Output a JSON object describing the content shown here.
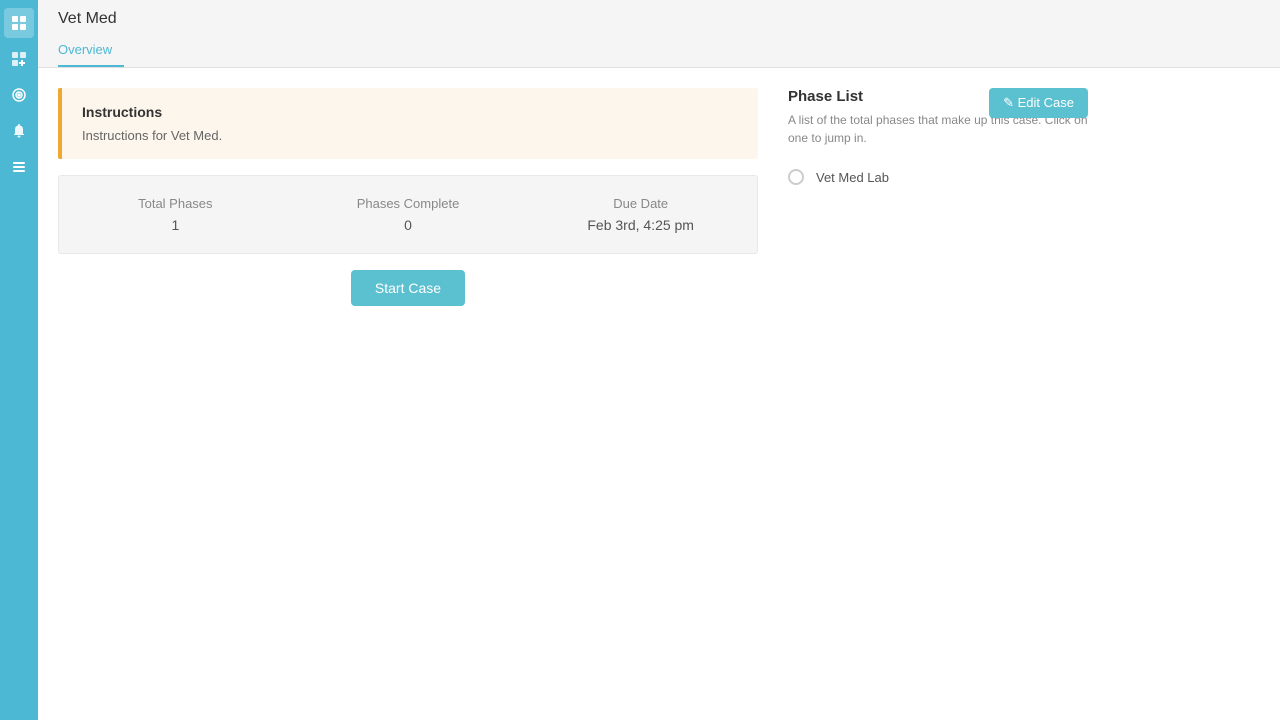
{
  "sidebar": {
    "icons": [
      {
        "name": "grid-icon",
        "symbol": "⊞"
      },
      {
        "name": "add-icon",
        "symbol": "⊕"
      },
      {
        "name": "target-icon",
        "symbol": "◎"
      },
      {
        "name": "bell-icon",
        "symbol": "🔔"
      },
      {
        "name": "list-icon",
        "symbol": "☰"
      }
    ]
  },
  "topbar": {
    "title": "Vet Med",
    "tabs": [
      {
        "label": "Overview",
        "active": true
      }
    ]
  },
  "edit_case_button": "✎ Edit Case",
  "instructions": {
    "title": "Instructions",
    "text": "Instructions for Vet Med."
  },
  "stats": {
    "total_phases_label": "Total Phases",
    "total_phases_value": "1",
    "phases_complete_label": "Phases Complete",
    "phases_complete_value": "0",
    "due_date_label": "Due Date",
    "due_date_value": "Feb 3rd, 4:25 pm"
  },
  "start_case_label": "Start Case",
  "phase_list": {
    "title": "Phase List",
    "description": "A list of the total phases that make up this case. Click on one to jump in.",
    "phases": [
      {
        "name": "Vet Med Lab"
      }
    ]
  },
  "colors": {
    "accent": "#5bc0d0",
    "sidebar_bg": "#4db8d4"
  }
}
